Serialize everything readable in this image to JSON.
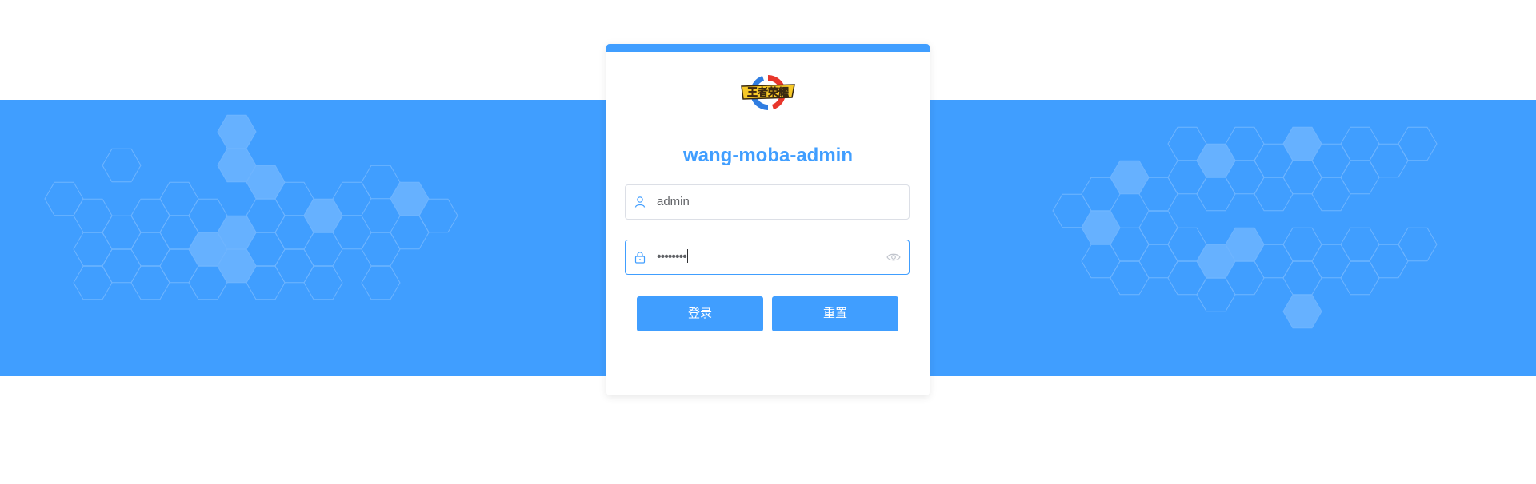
{
  "app": {
    "title": "wang-moba-admin"
  },
  "colors": {
    "primary": "#409eff",
    "background": "#ffffff",
    "hexagon_stroke": "#6fb5ff",
    "hexagon_fill": "#66b1ff"
  },
  "form": {
    "username": {
      "value": "admin",
      "icon": "user-icon"
    },
    "password": {
      "value": "••••••••",
      "icon": "lock-icon",
      "toggle_icon": "eye-icon"
    }
  },
  "buttons": {
    "login_label": "登录",
    "reset_label": "重置"
  }
}
